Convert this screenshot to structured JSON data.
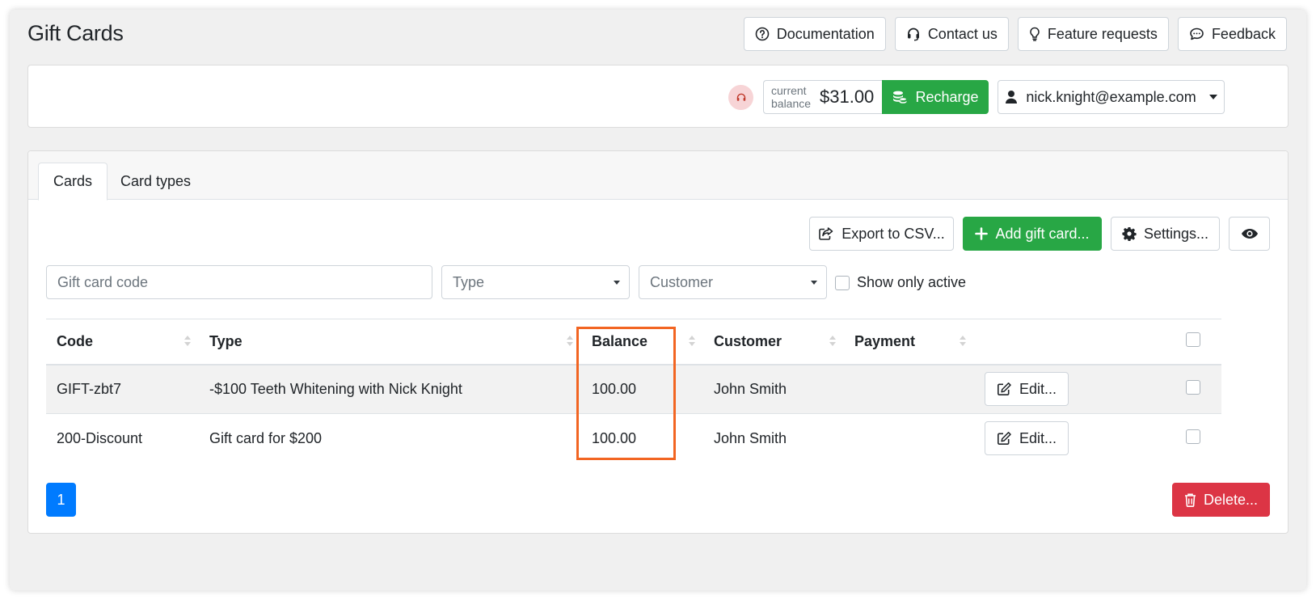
{
  "page": {
    "title": "Gift Cards"
  },
  "top_links": [
    {
      "label": "Documentation",
      "icon": "question-circle-icon"
    },
    {
      "label": "Contact us",
      "icon": "headset-icon"
    },
    {
      "label": "Feature requests",
      "icon": "lightbulb-icon"
    },
    {
      "label": "Feedback",
      "icon": "comment-icon"
    }
  ],
  "account": {
    "balance_label": "current balance",
    "balance_value": "$31.00",
    "recharge_label": "Recharge",
    "user_email": "nick.knight@example.com"
  },
  "tabs": [
    {
      "label": "Cards",
      "active": true
    },
    {
      "label": "Card types",
      "active": false
    }
  ],
  "toolbar": {
    "export_label": "Export to CSV...",
    "add_label": "Add gift card...",
    "settings_label": "Settings..."
  },
  "filters": {
    "code_placeholder": "Gift card code",
    "type_placeholder": "Type",
    "customer_placeholder": "Customer",
    "show_active_label": "Show only active"
  },
  "table": {
    "columns": [
      "Code",
      "Type",
      "Balance",
      "Customer",
      "Payment"
    ],
    "rows": [
      {
        "code": "GIFT-zbt7",
        "type": "-$100 Teeth Whitening with Nick Knight",
        "balance": "100.00",
        "customer": "John Smith",
        "payment": "",
        "edit_label": "Edit..."
      },
      {
        "code": "200-Discount",
        "type": "Gift card for $200",
        "balance": "100.00",
        "customer": "John Smith",
        "payment": "",
        "edit_label": "Edit..."
      }
    ]
  },
  "pagination": {
    "current": "1"
  },
  "footer": {
    "delete_label": "Delete..."
  },
  "colors": {
    "success": "#28a745",
    "danger": "#dc3545",
    "primary": "#007bff",
    "highlight": "#f26522"
  }
}
